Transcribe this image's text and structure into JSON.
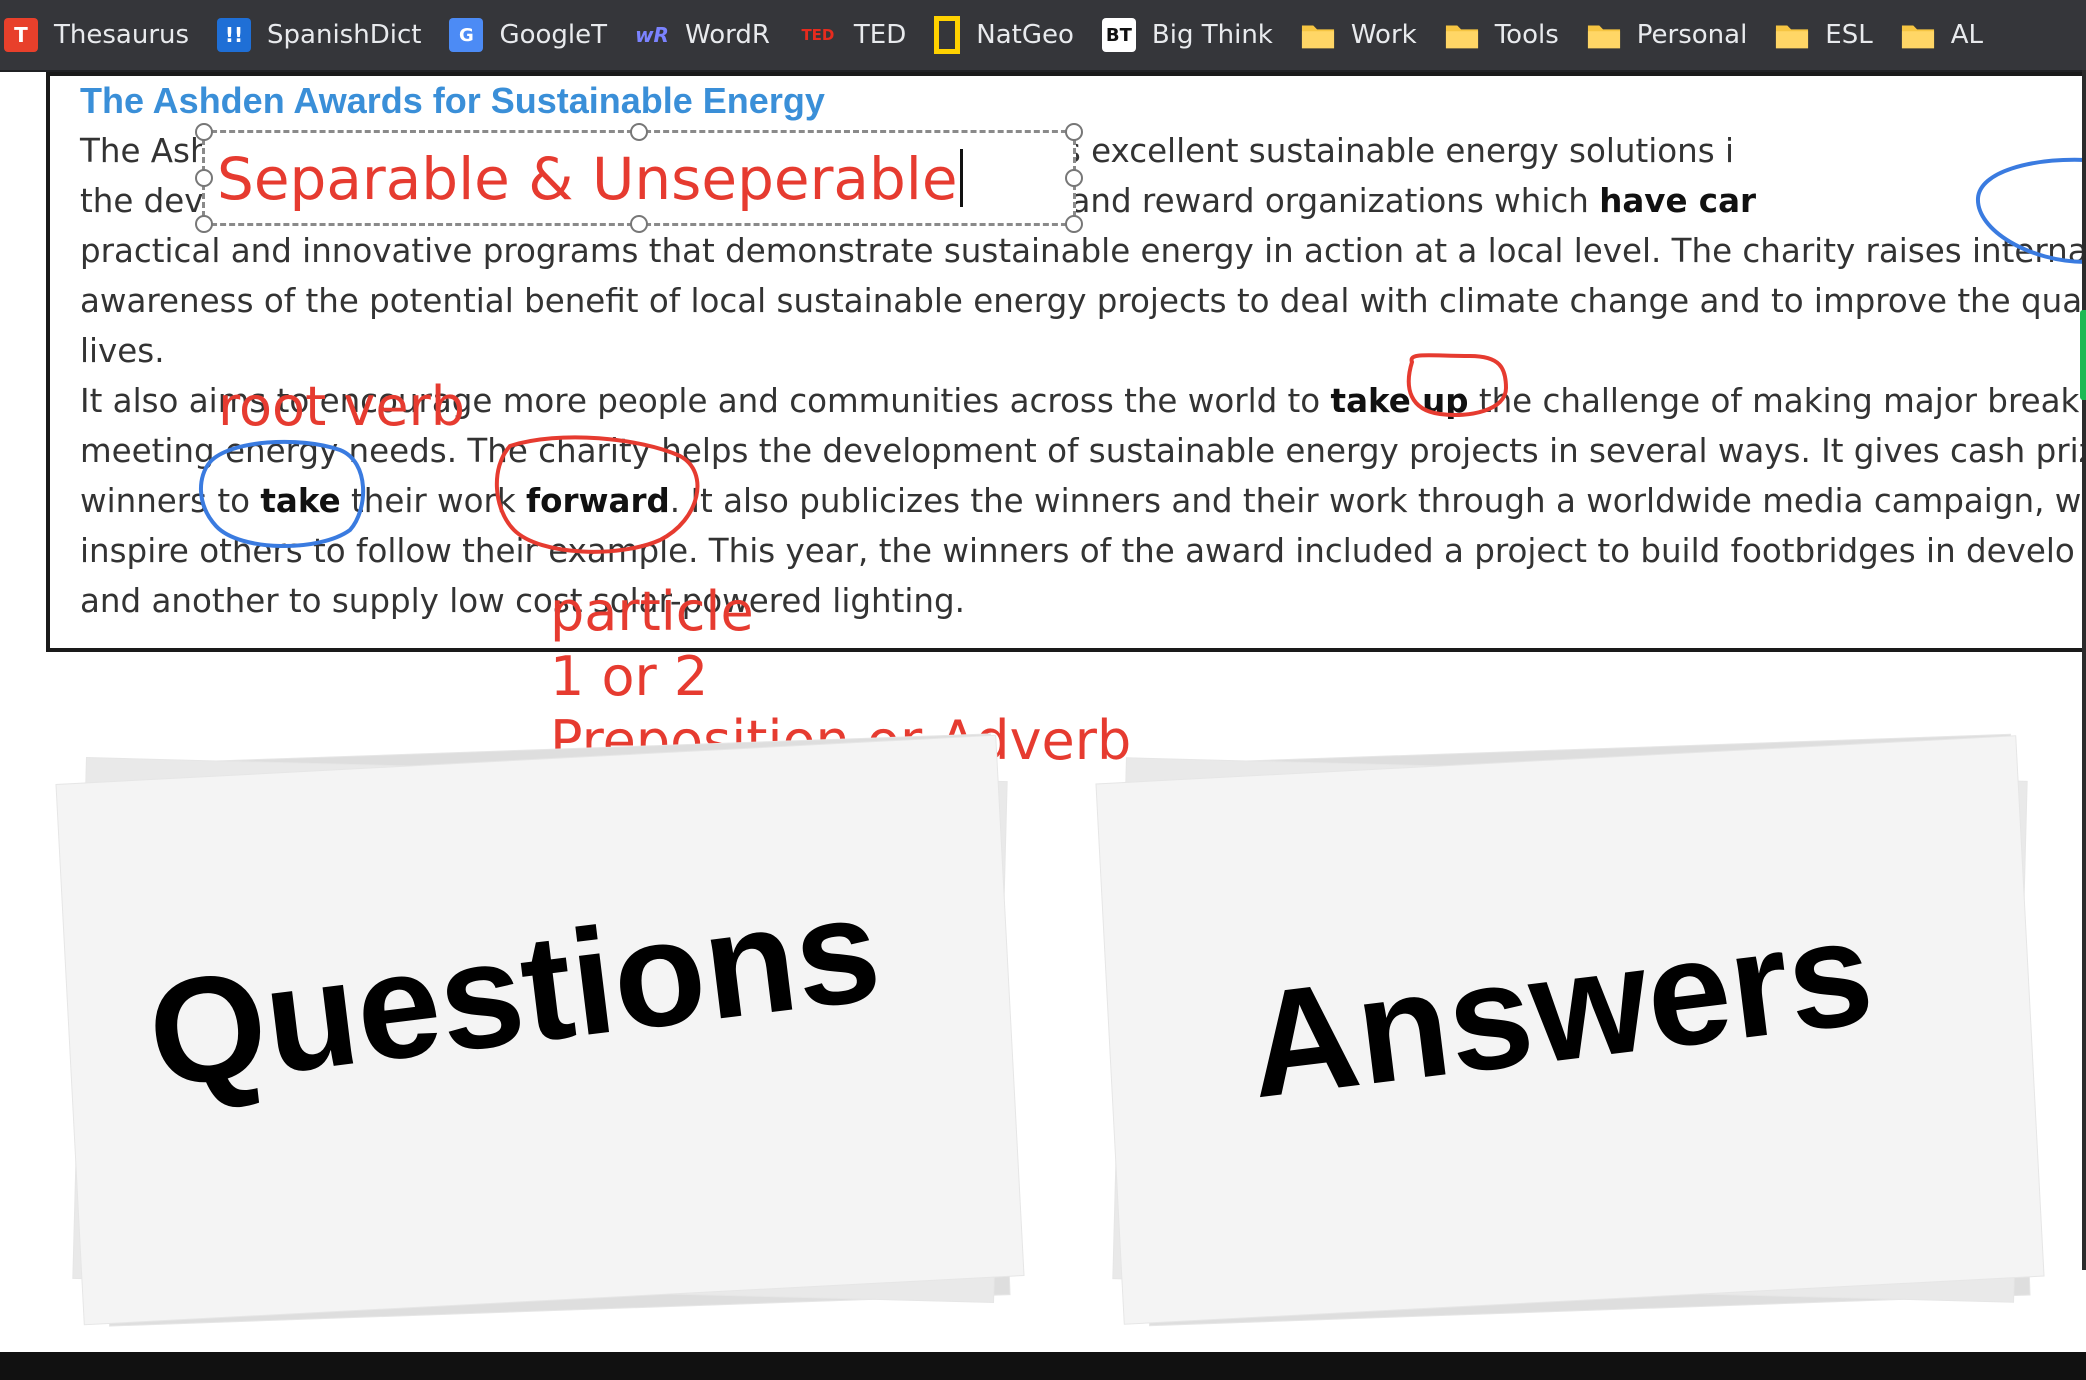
{
  "bookmarks": [
    {
      "label": "Thesaurus",
      "icon": "thesaurus-icon",
      "glyph": "T"
    },
    {
      "label": "SpanishDict",
      "icon": "spanishdict-icon",
      "glyph": "!!"
    },
    {
      "label": "GoogleT",
      "icon": "google-translate-icon",
      "glyph": "G"
    },
    {
      "label": "WordR",
      "icon": "wordreference-icon",
      "glyph": "wR"
    },
    {
      "label": "TED",
      "icon": "ted-icon",
      "glyph": "TED"
    },
    {
      "label": "NatGeo",
      "icon": "natgeo-icon",
      "glyph": ""
    },
    {
      "label": "Big Think",
      "icon": "bigthink-icon",
      "glyph": "BT"
    },
    {
      "label": "Work",
      "icon": "folder-icon"
    },
    {
      "label": "Tools",
      "icon": "folder-icon"
    },
    {
      "label": "Personal",
      "icon": "folder-icon"
    },
    {
      "label": "ESL",
      "icon": "folder-icon"
    },
    {
      "label": "AL",
      "icon": "folder-icon"
    }
  ],
  "document": {
    "title": "The Ashden Awards for Sustainable Energy",
    "lines": [
      {
        "segments": [
          {
            "t": "The Ash"
          },
          {
            "t": "                                                    ",
            "gap": true
          },
          {
            "t": "wards and promotes excellent sustainable energy solutions i"
          }
        ]
      },
      {
        "segments": [
          {
            "t": "the dev"
          },
          {
            "t": "                                                     ",
            "gap": true
          },
          {
            "t": "competition to find and reward organizations which "
          },
          {
            "t": "have car",
            "b": true
          }
        ]
      },
      {
        "segments": [
          {
            "t": "practical and innovative programs that demonstrate sustainable energy in action at a local level. The charity raises internat"
          }
        ]
      },
      {
        "segments": [
          {
            "t": "awareness of the potential benefit of local sustainable energy projects to deal with climate change and to improve the qual"
          }
        ]
      },
      {
        "segments": [
          {
            "t": "lives."
          }
        ]
      },
      {
        "segments": [
          {
            "t": "It also aims to encourage more people and communities across the world to "
          },
          {
            "t": "take up",
            "b": true
          },
          {
            "t": " the challenge of making major break"
          }
        ]
      },
      {
        "segments": [
          {
            "t": "meeting energy needs. The charity helps the development of sustainable energy projects in several ways. It gives cash prize"
          }
        ]
      },
      {
        "segments": [
          {
            "t": "winners to "
          },
          {
            "t": "take",
            "b": true
          },
          {
            "t": " their work "
          },
          {
            "t": "forward",
            "b": true
          },
          {
            "t": ". It also publicizes the winners and their work through a worldwide media campaign, w"
          }
        ]
      },
      {
        "segments": [
          {
            "t": "inspire others to follow their example. This year, the winners of the award included a project to build footbridges in develo"
          }
        ]
      },
      {
        "segments": [
          {
            "t": "and another to supply low cost solar-powered lighting."
          }
        ]
      }
    ]
  },
  "annotations": {
    "textbox": "Separable & Unseperable",
    "root_verb": "root verb",
    "particle": "particle",
    "count": "1 or 2",
    "kind": "Preposition or Adverb",
    "ink_colors": {
      "red": "#e63b30",
      "blue": "#3a7be0"
    }
  },
  "cards": {
    "left": "Questions",
    "right": "Answers"
  },
  "colors": {
    "bookmark_bar": "#35363a",
    "title_blue": "#3a8fd8",
    "annotation_red": "#e63b30"
  }
}
